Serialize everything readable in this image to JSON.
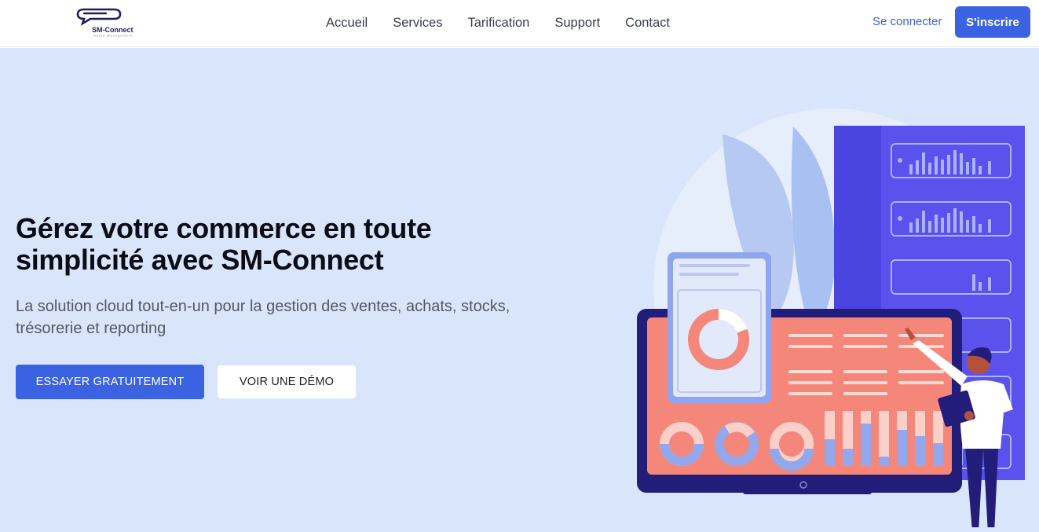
{
  "brand": {
    "name": "SM-Connect",
    "tagline": "Sales Management"
  },
  "nav": {
    "links": [
      "Accueil",
      "Services",
      "Tarification",
      "Support",
      "Contact"
    ],
    "login_label": "Se connecter",
    "signup_label": "S'inscrire"
  },
  "hero": {
    "title": "Gérez votre commerce en toute simplicité avec SM-Connect",
    "subtitle": "La solution cloud tout-en-un pour la gestion des ventes, achats, stocks, trésorerie et reporting",
    "primary_cta": "ESSAYER GRATUITEMENT",
    "secondary_cta": "VOIR UNE DÉMO"
  },
  "colors": {
    "accent": "#3b62e0",
    "hero_background": "#d8e5fb",
    "server": "#4a44e0",
    "monitor_screen": "#f5877a",
    "monitor_frame": "#231d7a"
  }
}
